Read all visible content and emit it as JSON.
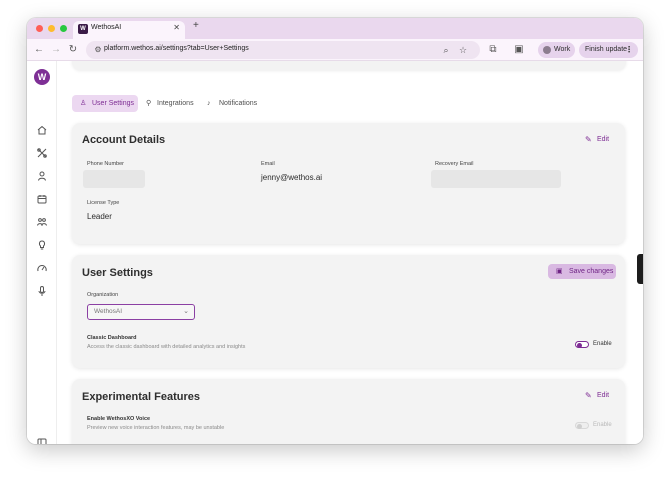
{
  "browser": {
    "tab_title": "WethosAI",
    "tab_favicon_letter": "W",
    "url": "platform.wethos.ai/settings?tab=User+Settings",
    "profile_label": "Work",
    "update_label": "Finish update"
  },
  "sidebar": {
    "logo_letter": "W",
    "items": [
      "home-icon",
      "tools-icon",
      "user-icon",
      "calendar-icon",
      "team-icon",
      "lightbulb-icon",
      "gauge-icon",
      "microphone-icon"
    ],
    "footer_icon": "sidebar-toggle-icon"
  },
  "tabs": [
    {
      "label": "User Settings",
      "icon": "user-icon",
      "active": true
    },
    {
      "label": "Integrations",
      "icon": "plug-icon",
      "active": false
    },
    {
      "label": "Notifications",
      "icon": "bell-icon",
      "active": false
    }
  ],
  "account": {
    "title": "Account Details",
    "edit_label": "Edit",
    "phone_label": "Phone Number",
    "phone_value": "",
    "email_label": "Email",
    "email_value": "jenny@wethos.ai",
    "recovery_label": "Recovery Email",
    "recovery_value": "",
    "license_label": "License Type",
    "license_value": "Leader"
  },
  "user_settings": {
    "title": "User Settings",
    "save_label": "Save changes",
    "org_label": "Organization",
    "org_value": "WethosAI",
    "classic_title": "Classic Dashboard",
    "classic_desc": "Access the classic dashboard with detailed analytics and insights",
    "classic_toggle_label": "Enable"
  },
  "experimental": {
    "title": "Experimental Features",
    "edit_label": "Edit",
    "voice_title": "Enable WethosXO Voice",
    "voice_desc": "Preview new voice interaction features, may be unstable",
    "voice_toggle_label": "Enable"
  },
  "colors": {
    "accent": "#7d2b93",
    "chrome": "#ead8ee",
    "card": "#f3f3f3"
  }
}
